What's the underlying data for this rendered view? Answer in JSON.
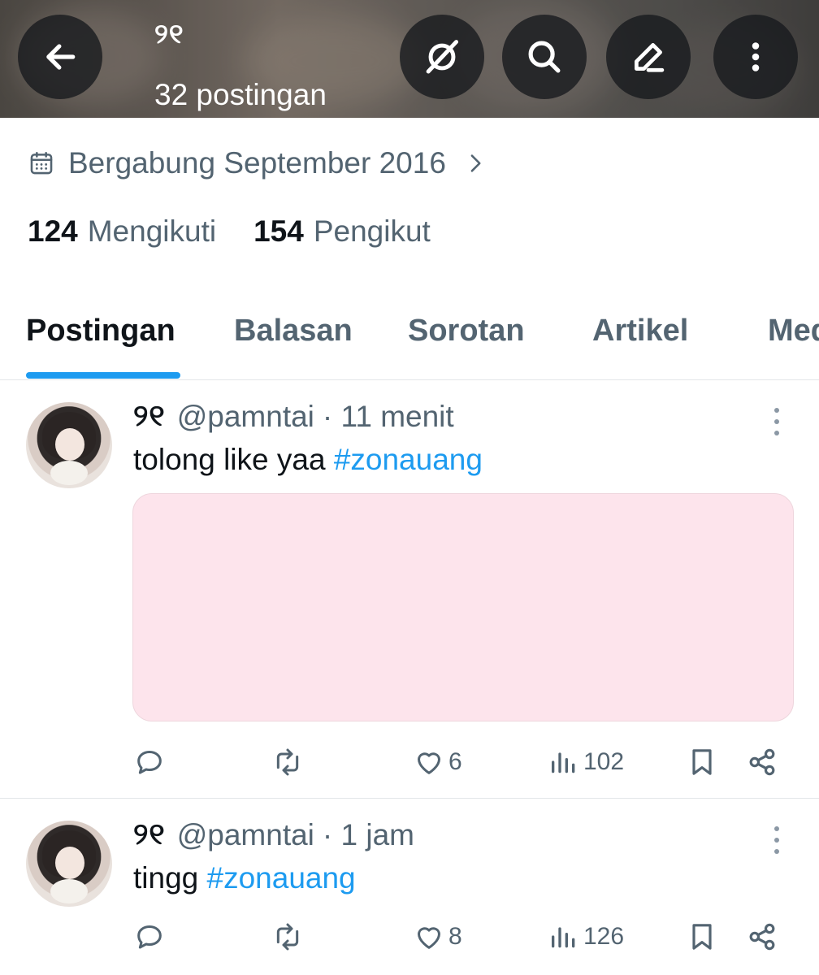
{
  "header": {
    "name": "୨୧",
    "post_count": "32 postingan",
    "buttons": [
      "back-icon",
      "grok-icon",
      "search-icon",
      "edit-icon",
      "more-vertical-icon"
    ]
  },
  "profile": {
    "joined": "Bergabung September 2016",
    "following_count": "124",
    "following_label": "Mengikuti",
    "followers_count": "154",
    "followers_label": "Pengikut"
  },
  "tabs": [
    {
      "label": "Postingan",
      "active": true
    },
    {
      "label": "Balasan",
      "active": false
    },
    {
      "label": "Sorotan",
      "active": false
    },
    {
      "label": "Artikel",
      "active": false
    },
    {
      "label": "Media",
      "active": false
    }
  ],
  "colors": {
    "accent": "#1d9bf0",
    "secondary_text": "#536471",
    "primary_text": "#0f1419",
    "media_placeholder": "#fde4ec"
  },
  "posts": [
    {
      "name": "୨୧",
      "handle": "@pamntai",
      "time": "· 11 menit",
      "text": "tolong like yaa ",
      "hashtag": "#zonauang",
      "has_media": true,
      "likes": "6",
      "views": "102"
    },
    {
      "name": "୨୧",
      "handle": "@pamntai",
      "time": "· 1 jam",
      "text": "tingg ",
      "hashtag": "#zonauang",
      "has_media": false,
      "likes": "8",
      "views": "126"
    }
  ]
}
